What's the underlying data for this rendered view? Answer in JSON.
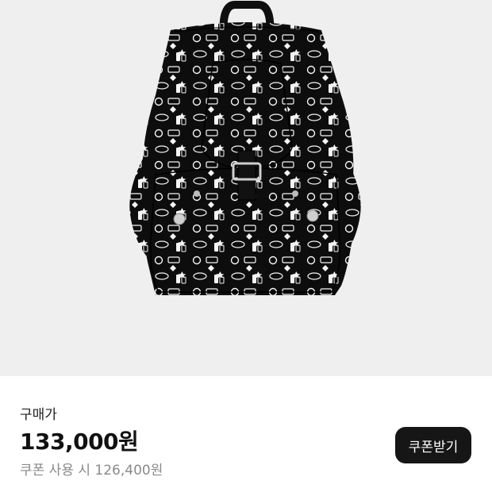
{
  "product": {
    "image_alt": "black backpack with white printed graphics"
  },
  "pricing": {
    "label": "구매가",
    "price": "133,000원",
    "coupon_price_text": "쿠폰 사용 시 126,400원"
  },
  "coupon_button": {
    "label": "쿠폰받기"
  }
}
